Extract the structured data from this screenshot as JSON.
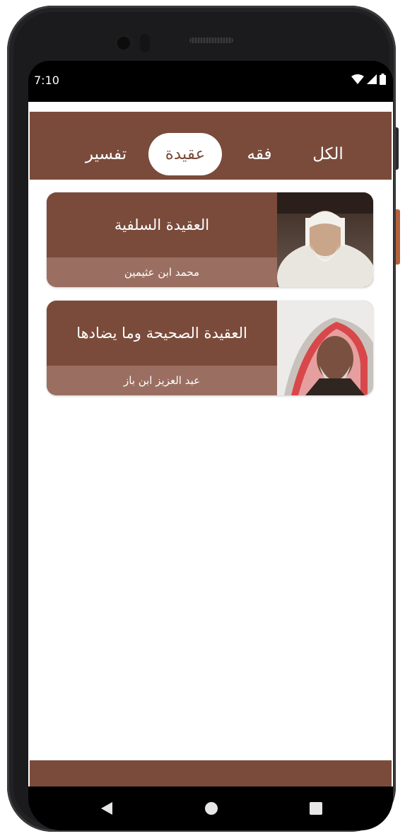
{
  "status_bar": {
    "time": "7:10"
  },
  "tabs": [
    {
      "label": "الكل",
      "active": false
    },
    {
      "label": "فقه",
      "active": false
    },
    {
      "label": "عقيدة",
      "active": true
    },
    {
      "label": "تفسير",
      "active": false
    }
  ],
  "cards": [
    {
      "title": "العقيدة السلفية",
      "author": "محمد ابن عثيمين"
    },
    {
      "title": "العقيدة الصحيحة وما يضادها",
      "author": "عبد العزيز ابن باز"
    }
  ],
  "bottom_nav": [
    {
      "icon": "bookmark-icon",
      "active": false
    },
    {
      "icon": "add-circle-icon",
      "active": false
    },
    {
      "icon": "search-icon",
      "active": false
    },
    {
      "icon": "home-icon",
      "active": true
    }
  ],
  "colors": {
    "primary": "#7a4b3b",
    "card_footer": "#9a6f62",
    "inactive_icon": "#8c5c4c",
    "active_icon": "#ffffff"
  }
}
